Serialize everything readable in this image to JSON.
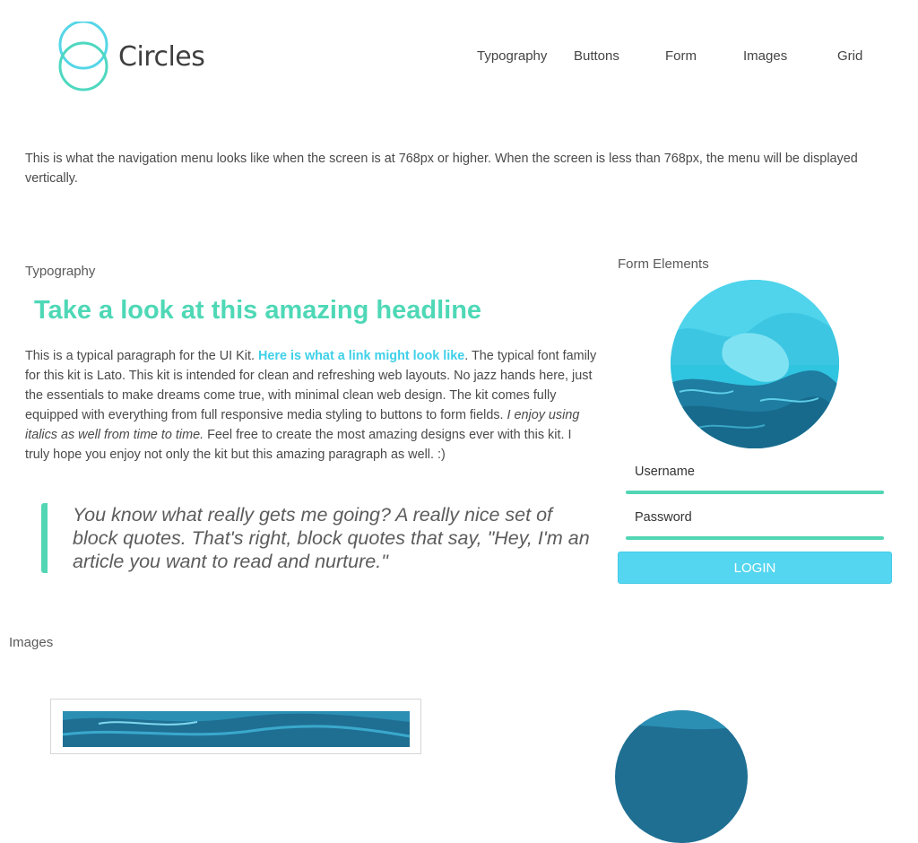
{
  "brand": {
    "name": "Circles",
    "icon": "circles-logo-icon",
    "color": "#4ed8c8"
  },
  "nav": {
    "items": [
      {
        "label": "Typography"
      },
      {
        "label": "Buttons"
      },
      {
        "label": "Form"
      },
      {
        "label": "Images"
      },
      {
        "label": "Grid"
      }
    ]
  },
  "intro": {
    "text": "This is what the navigation menu looks like when the screen is at 768px or higher. When the screen is less than 768px, the menu will be displayed vertically."
  },
  "typography": {
    "section_label": "Typography",
    "headline": "Take a look at this amazing headline",
    "paragraph_start": "This is a typical paragraph for the UI Kit. ",
    "link_text": "Here is what a link might look like",
    "paragraph_middle": ". The typical font family for this kit is Lato. This kit is intended for clean and refreshing web layouts. No jazz hands here, just the essentials to make dreams come true, with minimal clean web design. The kit comes fully equipped with everything from full responsive media styling to buttons to form fields. ",
    "italic_text": "I enjoy using italics as well from time to time.",
    "paragraph_end": " Feel free to create the most amazing designs ever with this kit. I truly hope you enjoy not only the kit but this amazing paragraph as well. :)",
    "blockquote": "You know what really gets me going? A really nice set of block quotes. That's right, block quotes that say, \"Hey, I'm an article you want to read and nurture.\""
  },
  "form": {
    "section_label": "Form Elements",
    "username_placeholder": "Username",
    "password_placeholder": "Password",
    "login_label": "LOGIN"
  },
  "images": {
    "section_label": "Images"
  },
  "colors": {
    "accent_green": "#52d6b4",
    "accent_blue": "#55d6f0",
    "link_blue": "#3fd0e8"
  }
}
